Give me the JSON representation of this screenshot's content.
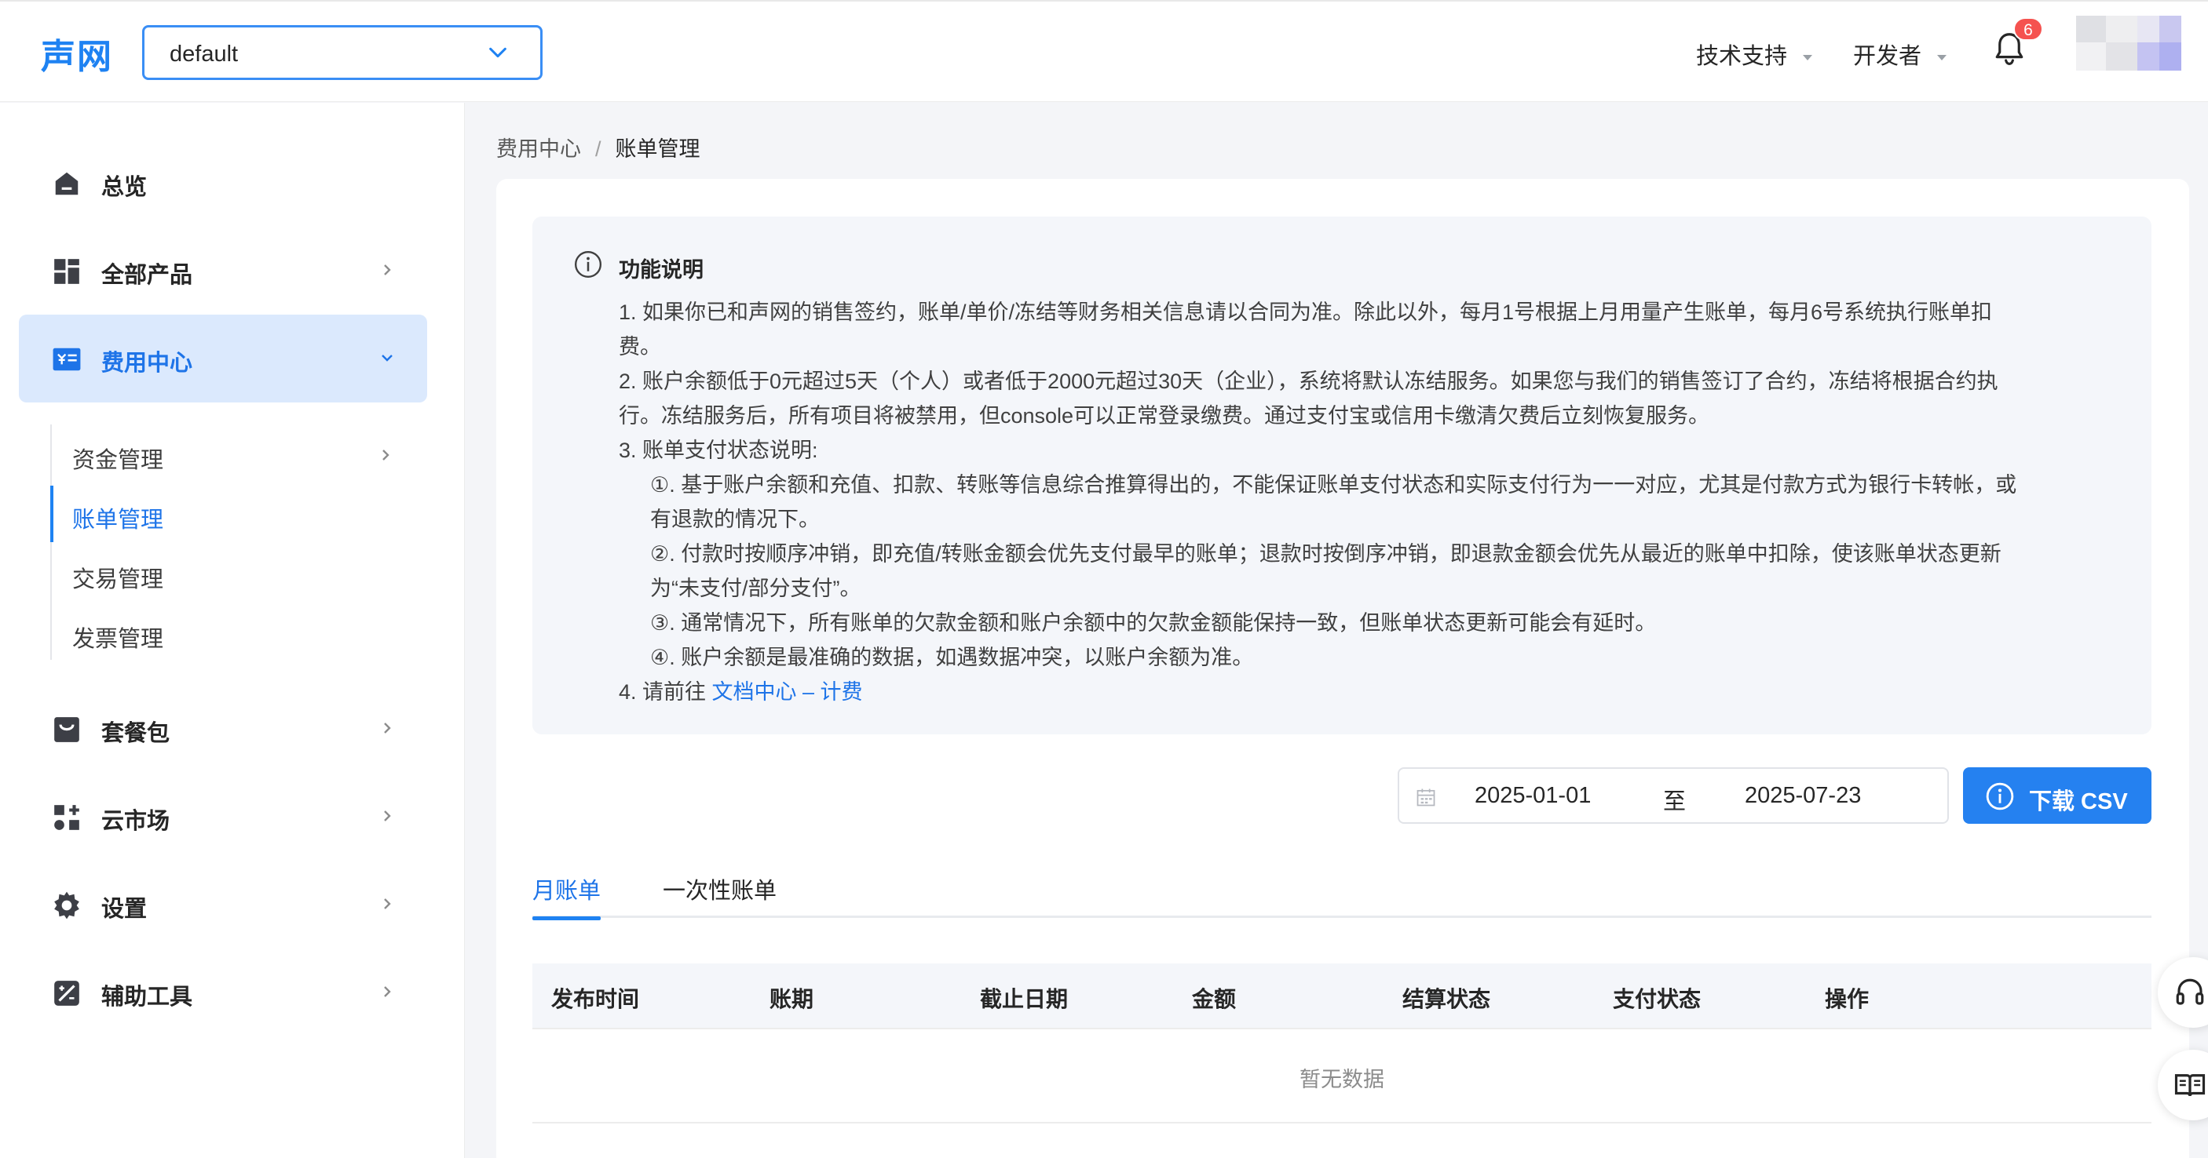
{
  "header": {
    "logo": "声网",
    "project": "default",
    "menus": [
      "技术支持",
      "开发者"
    ],
    "notification_count": "6"
  },
  "sidebar": {
    "items": [
      {
        "label": "总览",
        "icon": "home-icon"
      },
      {
        "label": "全部产品",
        "icon": "grid-icon"
      },
      {
        "label": "费用中心",
        "icon": "billing-icon"
      },
      {
        "label": "套餐包",
        "icon": "bag-icon"
      },
      {
        "label": "云市场",
        "icon": "market-icon"
      },
      {
        "label": "设置",
        "icon": "gear-icon"
      },
      {
        "label": "辅助工具",
        "icon": "tool-icon"
      }
    ],
    "sub_items": [
      "资金管理",
      "账单管理",
      "交易管理",
      "发票管理"
    ]
  },
  "breadcrumb": {
    "parent": "费用中心",
    "separator": "/",
    "current": "账单管理"
  },
  "notice": {
    "title": "功能说明",
    "lines": [
      "1. 如果你已和声网的销售签约，账单/单价/冻结等财务相关信息请以合同为准。除此以外，每月1号根据上月用量产生账单，每月6号系统执行账单扣",
      "费。",
      "2. 账户余额低于0元超过5天（个人）或者低于2000元超过30天（企业），系统将默认冻结服务。如果您与我们的销售签订了合约，冻结将根据合约执",
      "行。冻结服务后，所有项目将被禁用，但console可以正常登录缴费。通过支付宝或信用卡缴清欠费后立刻恢复服务。",
      "3. 账单支付状态说明:",
      "①. 基于账户余额和充值、扣款、转账等信息综合推算得出的，不能保证账单支付状态和实际支付行为一一对应，尤其是付款方式为银行卡转帐，或",
      "有退款的情况下。",
      "②. 付款时按顺序冲销，即充值/转账金额会优先支付最早的账单；退款时按倒序冲销，即退款金额会优先从最近的账单中扣除，使该账单状态更新",
      "为“未支付/部分支付”。",
      "③. 通常情况下，所有账单的欠款金额和账户余额中的欠款金额能保持一致，但账单状态更新可能会有延时。",
      "④. 账户余额是最准确的数据，如遇数据冲突，以账户余额为准。"
    ],
    "link_prefix": "4. 请前往 ",
    "link_text": "文档中心 – 计费"
  },
  "filters": {
    "start_date": "2025-01-01",
    "to_label": "至",
    "end_date": "2025-07-23",
    "download_label": "下载 CSV"
  },
  "tabs": [
    "月账单",
    "一次性账单"
  ],
  "table": {
    "columns": [
      "发布时间",
      "账期",
      "截止日期",
      "金额",
      "结算状态",
      "支付状态",
      "操作"
    ],
    "empty_text": "暂无数据"
  },
  "colors": {
    "accent": "#1e82f2",
    "active_bg": "#dbe9fd",
    "badge": "#f5524f"
  }
}
